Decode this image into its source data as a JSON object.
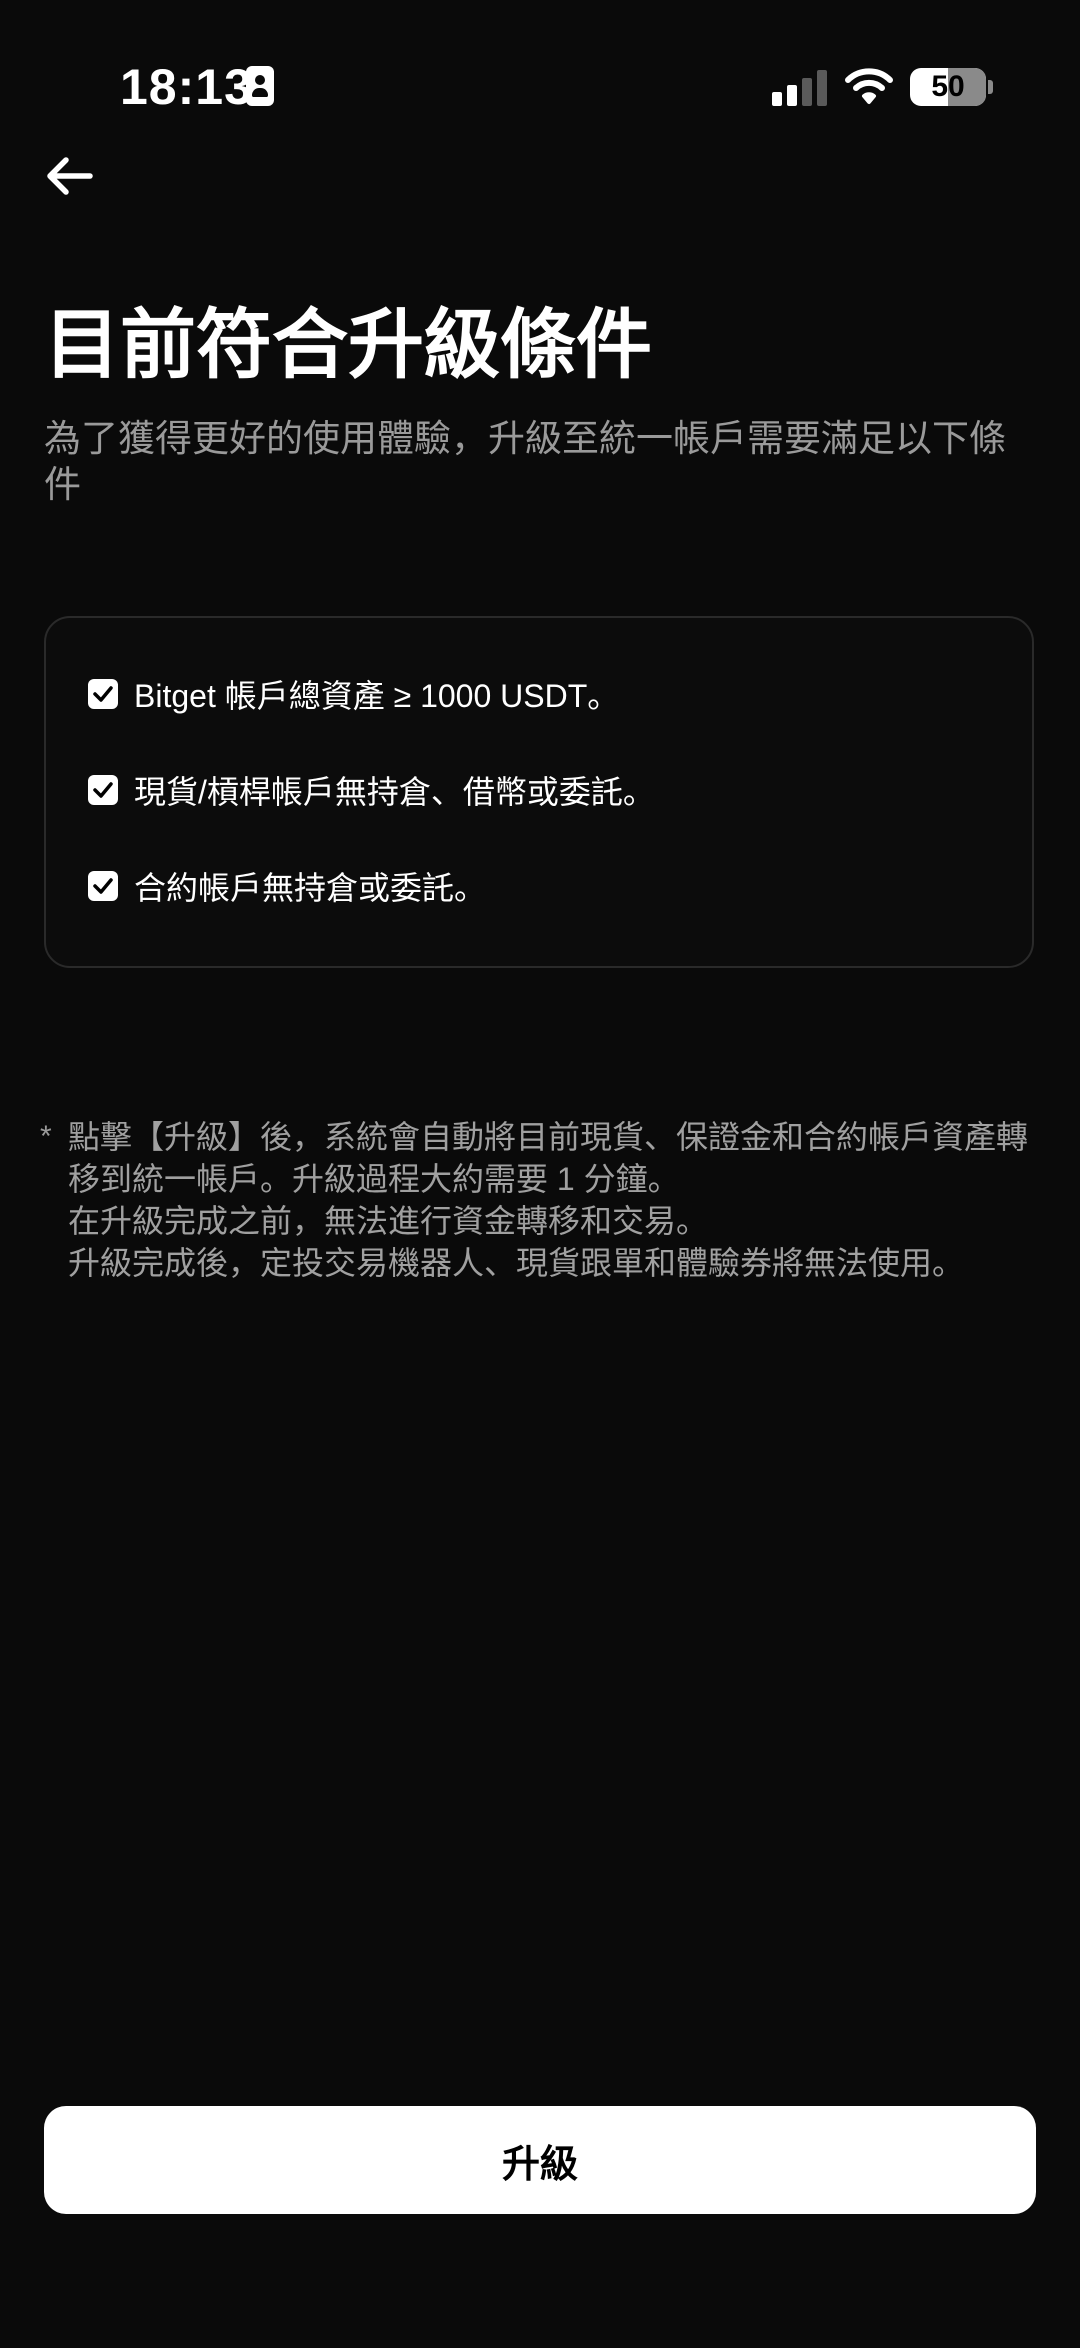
{
  "status_bar": {
    "time": "18:13",
    "battery_percent": "50",
    "signal_bars_active": 2,
    "signal_bars_total": 4,
    "icons": [
      "id-card-icon",
      "signal-icon",
      "wifi-icon",
      "battery-icon"
    ]
  },
  "header": {
    "back_icon": "arrow-left-icon"
  },
  "main": {
    "title": "目前符合升級條件",
    "subtitle": "為了獲得更好的使用體驗，升級至統一帳戶需要滿足以下條件",
    "conditions": [
      {
        "checked": true,
        "text": "Bitget 帳戶總資產 ≥ 1000 USDT。"
      },
      {
        "checked": true,
        "text": "現貨/槓桿帳戶無持倉、借幣或委託。"
      },
      {
        "checked": true,
        "text": "合約帳戶無持倉或委託。"
      }
    ],
    "notice": {
      "marker": "*",
      "lines": [
        "點擊【升級】後，系統會自動將目前現貨、保證金和合約帳戶資產轉",
        "移到統一帳戶。升級過程大約需要 1 分鐘。",
        "在升級完成之前，無法進行資金轉移和交易。",
        "升級完成後，定投交易機器人、現貨跟單和體驗券將無法使用。"
      ]
    }
  },
  "footer": {
    "upgrade_label": "升級"
  },
  "colors": {
    "background": "#0a0a0a",
    "primary_text": "#ffffff",
    "secondary_text": "#9a9a9a",
    "button_bg": "#ffffff",
    "button_text": "#000000",
    "card_border": "#2a2a2a"
  }
}
